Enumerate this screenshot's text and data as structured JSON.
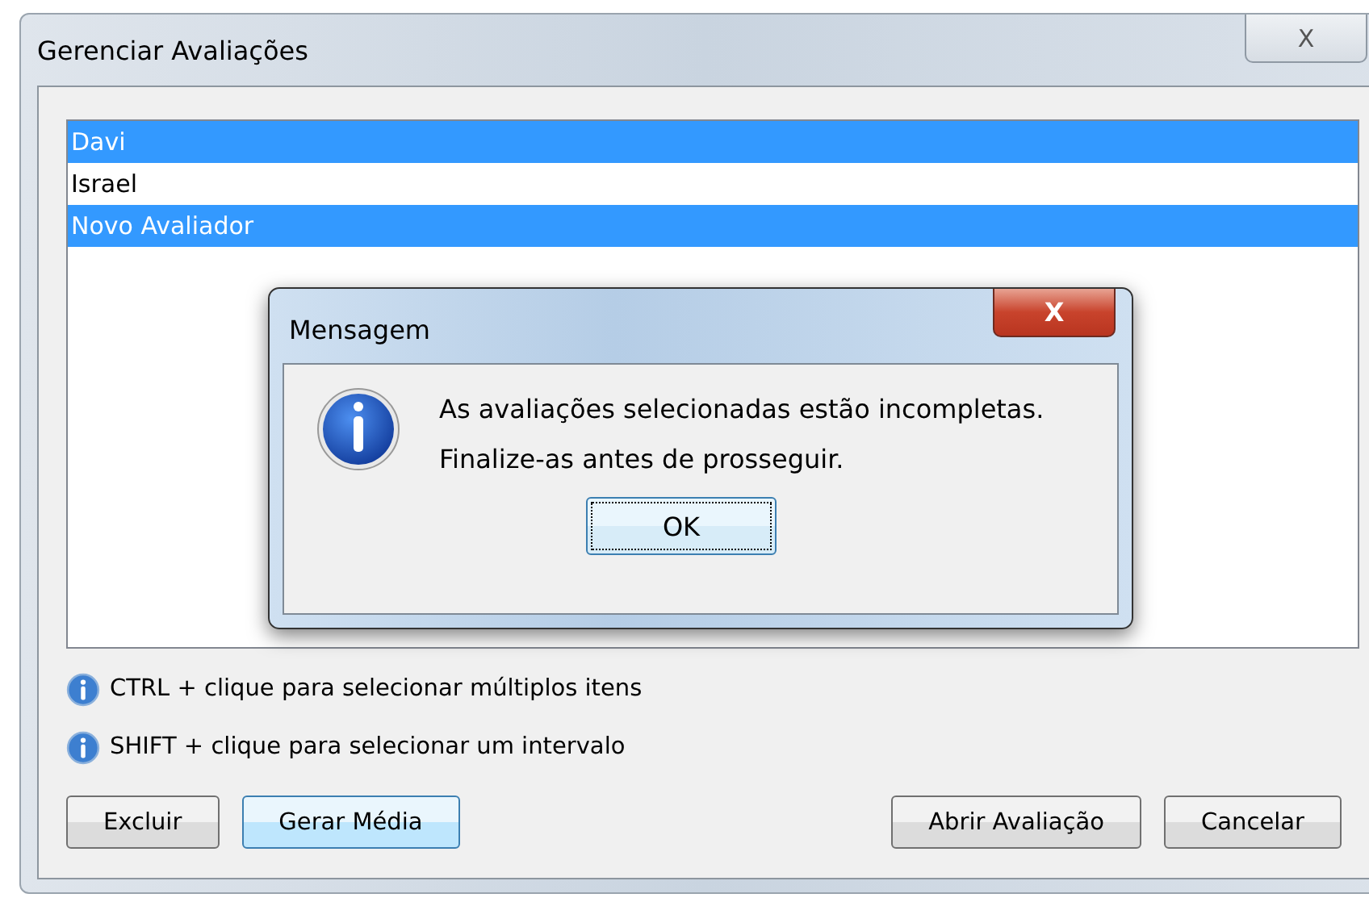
{
  "window": {
    "title": "Gerenciar Avaliações",
    "close": "X"
  },
  "list": {
    "items": [
      {
        "label": "Davi",
        "selected": true
      },
      {
        "label": "Israel",
        "selected": false
      },
      {
        "label": "Novo Avaliador",
        "selected": true
      }
    ]
  },
  "hints": [
    "CTRL + clique para selecionar múltiplos itens",
    "SHIFT + clique para selecionar um intervalo"
  ],
  "buttons_left": [
    {
      "label": "Excluir",
      "focused": false
    },
    {
      "label": "Gerar Média",
      "focused": true
    }
  ],
  "buttons_right": [
    {
      "label": "Abrir Avaliação",
      "focused": false
    },
    {
      "label": "Cancelar",
      "focused": false
    }
  ],
  "dialog": {
    "title": "Mensagem",
    "close": "X",
    "lines": [
      "As avaliações selecionadas estão incompletas.",
      "Finalize-as antes de prosseguir."
    ],
    "button": "OK"
  }
}
